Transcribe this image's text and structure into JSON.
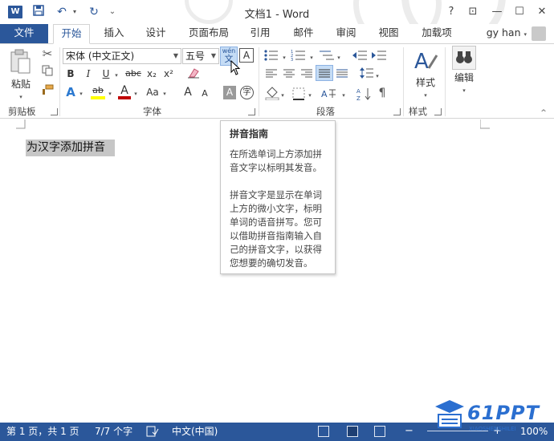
{
  "window": {
    "title": "文档1 - Word"
  },
  "quick_access": {
    "undo_glyph": "↶",
    "redo_glyph": "↻",
    "customize_glyph": "₹"
  },
  "window_controls": {
    "help": "?",
    "ribbon_display": "⊡",
    "minimize": "—",
    "maximize": "☐",
    "close": "✕"
  },
  "tabs": {
    "file": "文件",
    "items": [
      "开始",
      "插入",
      "设计",
      "页面布局",
      "引用",
      "邮件",
      "审阅",
      "视图",
      "加载项"
    ],
    "active_index": 0
  },
  "user": {
    "name": "gy han"
  },
  "ribbon": {
    "clipboard": {
      "paste_label": "粘贴",
      "group_label": "剪贴板"
    },
    "font": {
      "font_name": "宋体 (中文正文)",
      "font_size": "五号",
      "phonetic_top": "wén",
      "phonetic_bottom": "文",
      "char_border": "A",
      "bold": "B",
      "italic": "I",
      "underline": "U",
      "strikethrough": "abc",
      "subscript": "x₂",
      "superscript": "x²",
      "text_effects": "A",
      "highlight": "ab",
      "font_color": "A",
      "change_case": "Aa",
      "grow": "A",
      "shrink": "A",
      "shading": "A",
      "enclose": "字",
      "group_label": "字体"
    },
    "paragraph": {
      "group_label": "段落"
    },
    "styles": {
      "label": "样式",
      "group_label": "样式"
    },
    "editing": {
      "label": "编辑"
    }
  },
  "document": {
    "selected_text": "为汉字添加拼音"
  },
  "tooltip": {
    "title": "拼音指南",
    "lines_1": [
      "在所选单词上方添加拼",
      "音文字以标明其发音。"
    ],
    "lines_2": [
      "拼音文字是显示在单词",
      "上方的微小文字，标明",
      "单词的语音拼写。您可",
      "以借助拼音指南输入自",
      "己的拼音文字，以获得",
      "您想要的确切发音。"
    ]
  },
  "status_bar": {
    "page": "第 1 页，共 1 页",
    "words": "7/7 个字",
    "language": "中文(中国)",
    "zoom": "100%"
  },
  "watermark": {
    "text": "61PPT",
    "sub": "XIAOSHENSHILEI"
  },
  "colors": {
    "brand": "#2b579a",
    "highlight": "#ffff00",
    "font_red": "#c00000"
  }
}
